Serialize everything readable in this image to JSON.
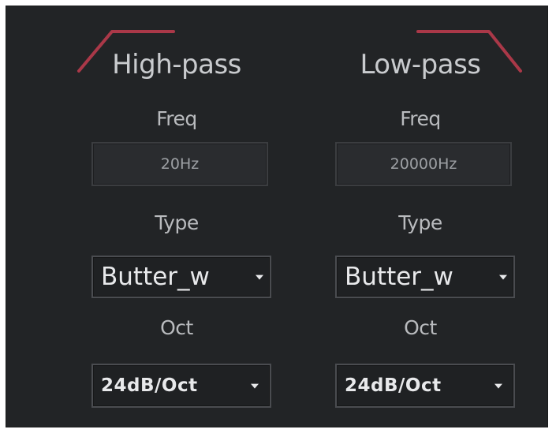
{
  "highpass": {
    "title": "High-pass",
    "freq_label": "Freq",
    "freq_value": "20Hz",
    "type_label": "Type",
    "type_value": "Butter_w",
    "oct_label": "Oct",
    "oct_value": "24dB/Oct"
  },
  "lowpass": {
    "title": "Low-pass",
    "freq_label": "Freq",
    "freq_value": "20000Hz",
    "type_label": "Type",
    "type_value": "Butter_w",
    "oct_label": "Oct",
    "oct_value": "24dB/Oct"
  },
  "colors": {
    "panel_bg": "#222426",
    "curve_accent": "#b23a4a",
    "text": "#c9cbce"
  },
  "icons": {
    "highpass_curve": "highpass-curve-icon",
    "lowpass_curve": "lowpass-curve-icon",
    "dropdown": "chevron-down-icon"
  }
}
